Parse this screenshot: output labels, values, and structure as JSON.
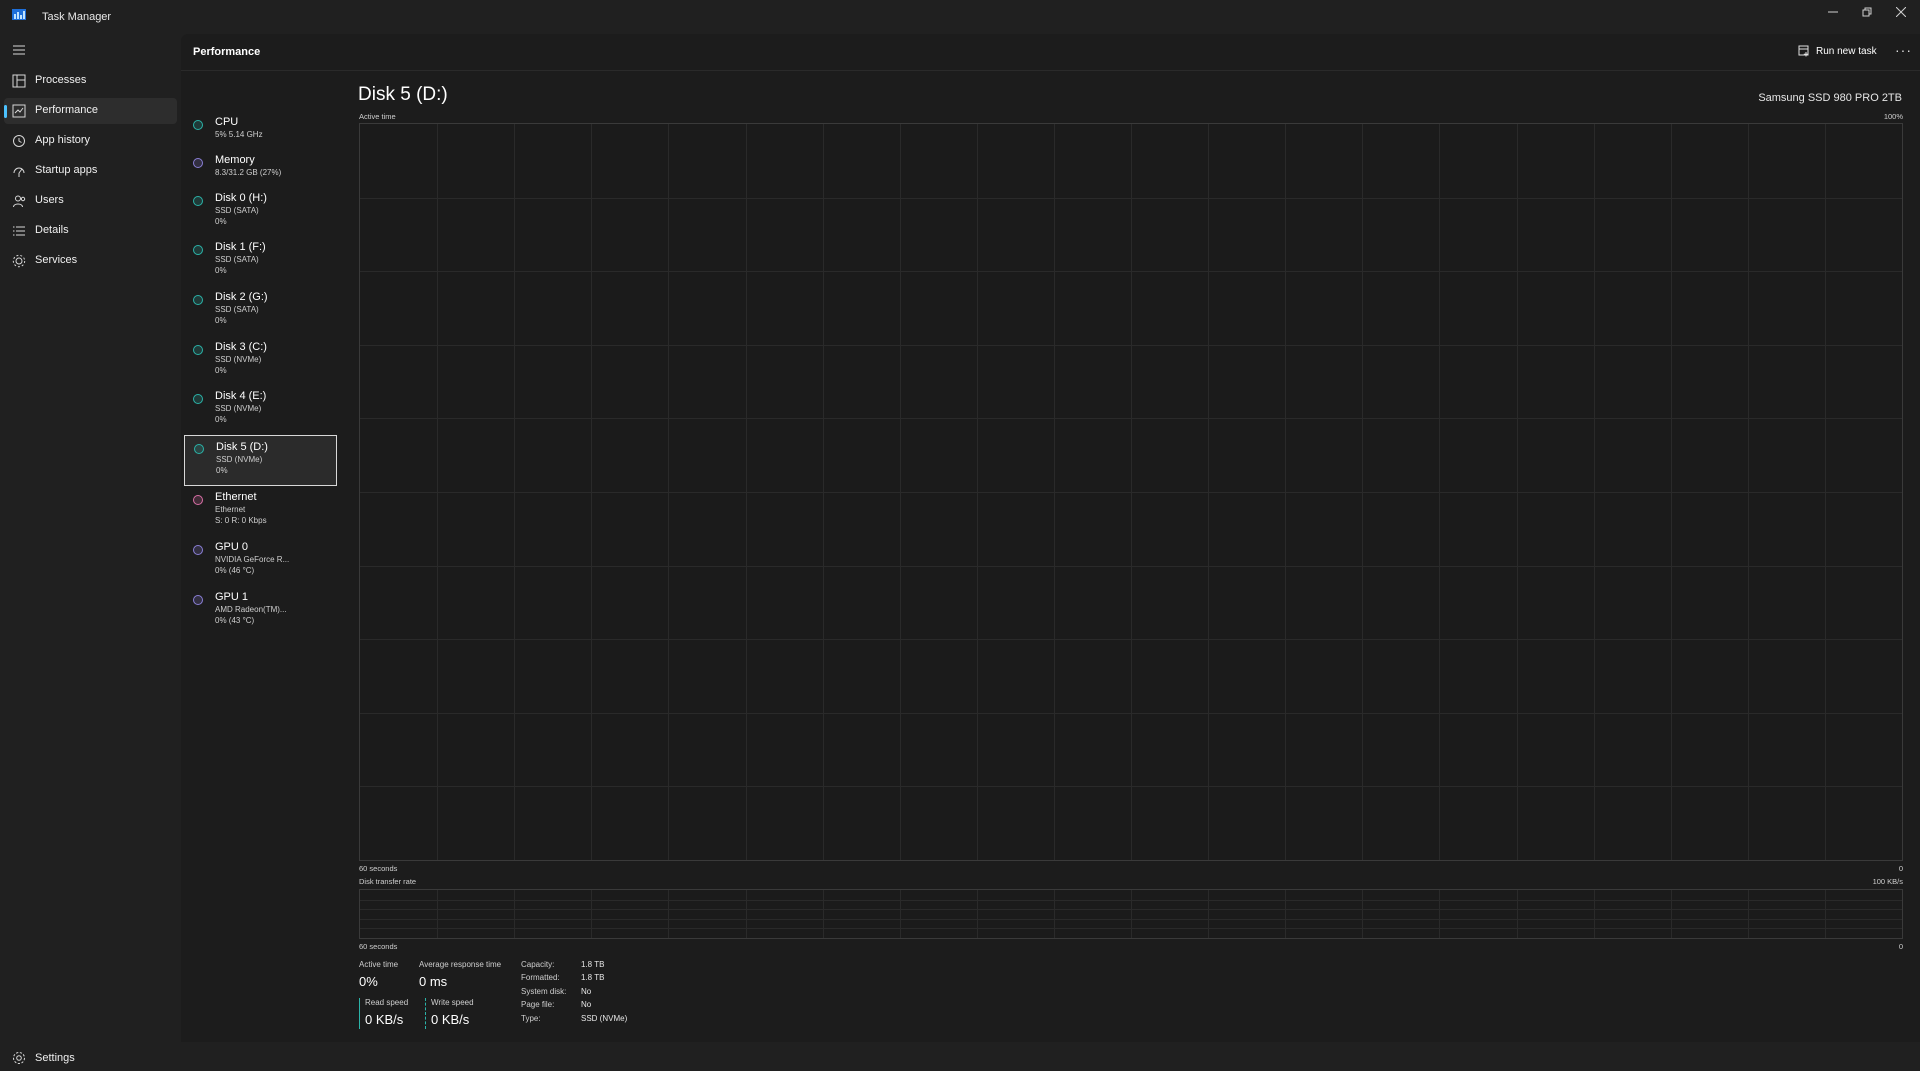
{
  "window": {
    "title": "Task Manager"
  },
  "nav": {
    "items": [
      {
        "label": "Processes",
        "icon": "processes-icon"
      },
      {
        "label": "Performance",
        "icon": "performance-icon",
        "active": true
      },
      {
        "label": "App history",
        "icon": "history-icon"
      },
      {
        "label": "Startup apps",
        "icon": "startup-icon"
      },
      {
        "label": "Users",
        "icon": "users-icon"
      },
      {
        "label": "Details",
        "icon": "details-icon"
      },
      {
        "label": "Services",
        "icon": "services-icon"
      }
    ],
    "settings": "Settings"
  },
  "header": {
    "title": "Performance",
    "run_new_task": "Run new task",
    "more": "···"
  },
  "devices": [
    {
      "name": "CPU",
      "sub1": "5% 5.14 GHz",
      "sub2": "",
      "color": "#2bb3a8"
    },
    {
      "name": "Memory",
      "sub1": "8.3/31.2 GB (27%)",
      "sub2": "",
      "color": "#8a7fd6"
    },
    {
      "name": "Disk 0 (H:)",
      "sub1": "SSD (SATA)",
      "sub2": "0%",
      "color": "#2bb3a8"
    },
    {
      "name": "Disk 1 (F:)",
      "sub1": "SSD (SATA)",
      "sub2": "0%",
      "color": "#2bb3a8"
    },
    {
      "name": "Disk 2 (G:)",
      "sub1": "SSD (SATA)",
      "sub2": "0%",
      "color": "#2bb3a8"
    },
    {
      "name": "Disk 3 (C:)",
      "sub1": "SSD (NVMe)",
      "sub2": "0%",
      "color": "#2bb3a8"
    },
    {
      "name": "Disk 4 (E:)",
      "sub1": "SSD (NVMe)",
      "sub2": "0%",
      "color": "#2bb3a8"
    },
    {
      "name": "Disk 5 (D:)",
      "sub1": "SSD (NVMe)",
      "sub2": "0%",
      "color": "#2bb3a8",
      "selected": true
    },
    {
      "name": "Ethernet",
      "sub1": "Ethernet",
      "sub2": "S: 0 R: 0 Kbps",
      "color": "#d86fa6"
    },
    {
      "name": "GPU 0",
      "sub1": "NVIDIA GeForce R...",
      "sub2": "0% (46 °C)",
      "color": "#8a7fd6"
    },
    {
      "name": "GPU 1",
      "sub1": "AMD Radeon(TM)...",
      "sub2": "0% (43 °C)",
      "color": "#8a7fd6"
    }
  ],
  "detail": {
    "title": "Disk 5 (D:)",
    "model": "Samsung SSD 980 PRO 2TB",
    "active_graph": {
      "label": "Active time",
      "max": "100%",
      "xlabel": "60 seconds",
      "min": "0"
    },
    "transfer_graph": {
      "label": "Disk transfer rate",
      "max": "100 KB/s",
      "xlabel": "60 seconds",
      "min": "0"
    },
    "stats": {
      "active_time_label": "Active time",
      "active_time_value": "0%",
      "avg_response_label": "Average response time",
      "avg_response_value": "0 ms",
      "read_label": "Read speed",
      "read_value": "0 KB/s",
      "write_label": "Write speed",
      "write_value": "0 KB/s"
    },
    "properties": [
      {
        "key": "Capacity:",
        "value": "1.8 TB"
      },
      {
        "key": "Formatted:",
        "value": "1.8 TB"
      },
      {
        "key": "System disk:",
        "value": "No"
      },
      {
        "key": "Page file:",
        "value": "No"
      },
      {
        "key": "Type:",
        "value": "SSD (NVMe)"
      }
    ]
  },
  "colors": {
    "accent": "#4cc2ff",
    "disk": "#2bb3a8",
    "memory": "#8a7fd6",
    "ethernet": "#d86fa6"
  }
}
